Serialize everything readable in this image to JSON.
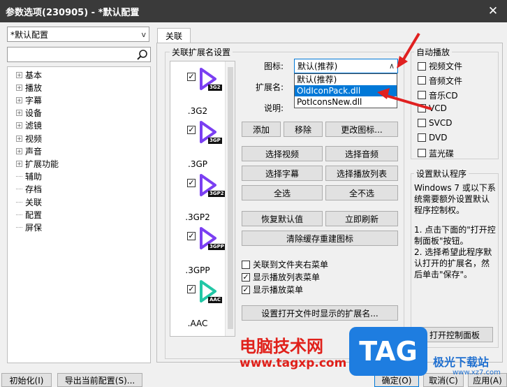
{
  "window": {
    "title": "参数选项(230905) - *默认配置",
    "close_glyph": "✕"
  },
  "preset": {
    "value": "*默认配置",
    "chevron": "v"
  },
  "search": {
    "placeholder": "",
    "icon": "search-icon"
  },
  "tree": {
    "items": [
      {
        "label": "基本",
        "expandable": true
      },
      {
        "label": "播放",
        "expandable": true
      },
      {
        "label": "字幕",
        "expandable": true
      },
      {
        "label": "设备",
        "expandable": true
      },
      {
        "label": "滤镜",
        "expandable": true
      },
      {
        "label": "视频",
        "expandable": true
      },
      {
        "label": "声音",
        "expandable": true
      },
      {
        "label": "扩展功能",
        "expandable": true
      },
      {
        "label": "辅助",
        "expandable": false
      },
      {
        "label": "存档",
        "expandable": false
      },
      {
        "label": "关联",
        "expandable": false
      },
      {
        "label": "配置",
        "expandable": false
      },
      {
        "label": "屏保",
        "expandable": false
      }
    ],
    "expand_glyph": "+"
  },
  "tab": {
    "label": "关联"
  },
  "assoc": {
    "group_title": "关联扩展名设置",
    "extensions": [
      {
        "label": ".3G2",
        "badge": "3G2",
        "color": "#7b3ff2",
        "checked": true
      },
      {
        "label": ".3GP",
        "badge": "3GP",
        "color": "#7b3ff2",
        "checked": true
      },
      {
        "label": ".3GP2",
        "badge": "3GP2",
        "color": "#7b3ff2",
        "checked": true
      },
      {
        "label": ".3GPP",
        "badge": "3GPP",
        "color": "#7b3ff2",
        "checked": true
      },
      {
        "label": ".AAC",
        "badge": "AAC",
        "color": "#22c7a6",
        "checked": true
      }
    ],
    "check_glyph": "✓",
    "icon_label": "图标:",
    "icon_value": "默认(推荐)",
    "icon_chevron": "∧",
    "ext_label": "扩展名:",
    "desc_label": "说明:",
    "dropdown_options": [
      {
        "label": "默认(推荐)",
        "selected": false
      },
      {
        "label": "OldIconPack.dll",
        "selected": true
      },
      {
        "label": "PotIconsNew.dll",
        "selected": false
      }
    ],
    "buttons": {
      "add": "添加",
      "remove": "移除",
      "change_icon": "更改图标...",
      "select_video": "选择视频",
      "select_audio": "选择音频",
      "select_subtitle": "选择字幕",
      "select_playlist": "选择播放列表",
      "select_all": "全选",
      "select_none": "全不选",
      "restore_default": "恢复默认值",
      "refresh_now": "立即刷新",
      "clear_cache": "清除缓存重建图标",
      "set_open_ext": "设置打开文件时显示的扩展名..."
    },
    "checkboxes": [
      {
        "label": "关联到文件夹右菜单",
        "checked": false
      },
      {
        "label": "显示播放列表菜单",
        "checked": true
      },
      {
        "label": "显示播放菜单",
        "checked": true
      }
    ]
  },
  "autoplay": {
    "title": "自动播放",
    "items": [
      {
        "label": "视频文件",
        "checked": false
      },
      {
        "label": "音频文件",
        "checked": false
      },
      {
        "label": "音乐CD",
        "checked": false
      },
      {
        "label": "VCD",
        "checked": false
      },
      {
        "label": "SVCD",
        "checked": false
      },
      {
        "label": "DVD",
        "checked": false
      },
      {
        "label": "蓝光碟",
        "checked": false
      }
    ]
  },
  "default_program": {
    "title": "设置默认程序",
    "text1": "Windows 7 或以下系统需要额外设置默认程序控制权。",
    "text2": "1. 点击下面的\"打开控制面板\"按钮。",
    "text3": "2. 选择希望此程序默认打开的扩展名，然后单击\"保存\"。",
    "open_panel_button": "打开控制面板"
  },
  "footer": {
    "init": "初始化(I)",
    "export": "导出当前配置(S)...",
    "ok": "确定(O)",
    "cancel": "取消(C)",
    "apply": "应用(A)"
  },
  "watermark": {
    "site_name": "电脑技术网",
    "url": "www.tagxp.com",
    "tag": "TAG",
    "right_text": "极光下载站",
    "right_url": "www.xz7.com"
  },
  "colors": {
    "titlebar": "#3a3a3a",
    "selection": "#0078d7",
    "arrow": "#e02020",
    "tag_blue": "#1e7de0"
  }
}
